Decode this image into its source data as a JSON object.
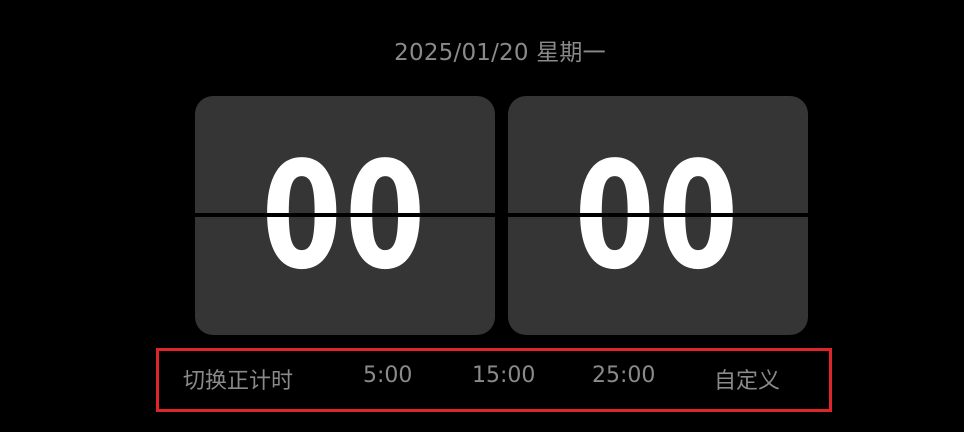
{
  "date": "2025/01/20 星期一",
  "clock": {
    "hours": "00",
    "minutes": "00"
  },
  "presets": {
    "switch_label": "切换正计时",
    "p5_label": "5:00",
    "p15_label": "15:00",
    "p25_label": "25:00",
    "custom_label": "自定义"
  },
  "colors": {
    "background": "#000000",
    "card": "#353535",
    "digits": "#ffffff",
    "muted_text": "#8a8a8a",
    "highlight_border": "#e0242c"
  }
}
